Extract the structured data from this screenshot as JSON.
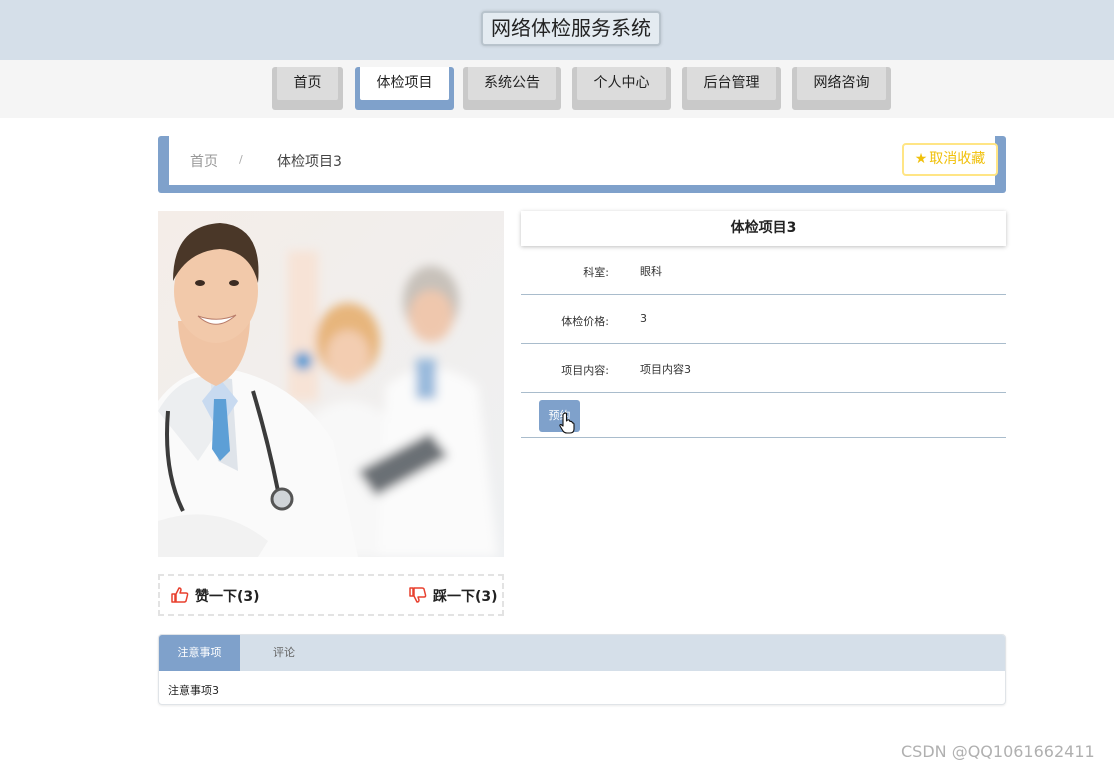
{
  "header": {
    "title": "网络体检服务系统"
  },
  "nav": {
    "items": [
      {
        "label": "首页",
        "active": false
      },
      {
        "label": "体检项目",
        "active": true
      },
      {
        "label": "系统公告",
        "active": false
      },
      {
        "label": "个人中心",
        "active": false
      },
      {
        "label": "后台管理",
        "active": false
      },
      {
        "label": "网络咨询",
        "active": false
      }
    ]
  },
  "breadcrumb": {
    "home": "首页",
    "separator": "/",
    "current": "体检项目3"
  },
  "favorite": {
    "label": "取消收藏",
    "icon": "star-icon",
    "color": "#f0c00a"
  },
  "photo": {
    "icon": "doctor-photo"
  },
  "votes": {
    "like_label": "赞一下(3)",
    "dislike_label": "踩一下(3)",
    "like_icon": "thumbs-up-icon",
    "dislike_icon": "thumbs-down-icon"
  },
  "detail": {
    "title": "体检项目3",
    "fields": [
      {
        "label": "科室:",
        "value": "眼科"
      },
      {
        "label": "体检价格:",
        "value": "3"
      },
      {
        "label": "项目内容:",
        "value": "项目内容3"
      }
    ],
    "book_label": "预约"
  },
  "tabs": {
    "items": [
      {
        "label": "注意事项",
        "active": true
      },
      {
        "label": "评论",
        "active": false
      }
    ],
    "content": "注意事项3"
  },
  "watermark": "CSDN @QQ1061662411",
  "colors": {
    "accent": "#7fa1cb",
    "header_bg": "#d5dfe9",
    "favorite": "#f0c00a",
    "vote_icon": "#e8402f"
  }
}
